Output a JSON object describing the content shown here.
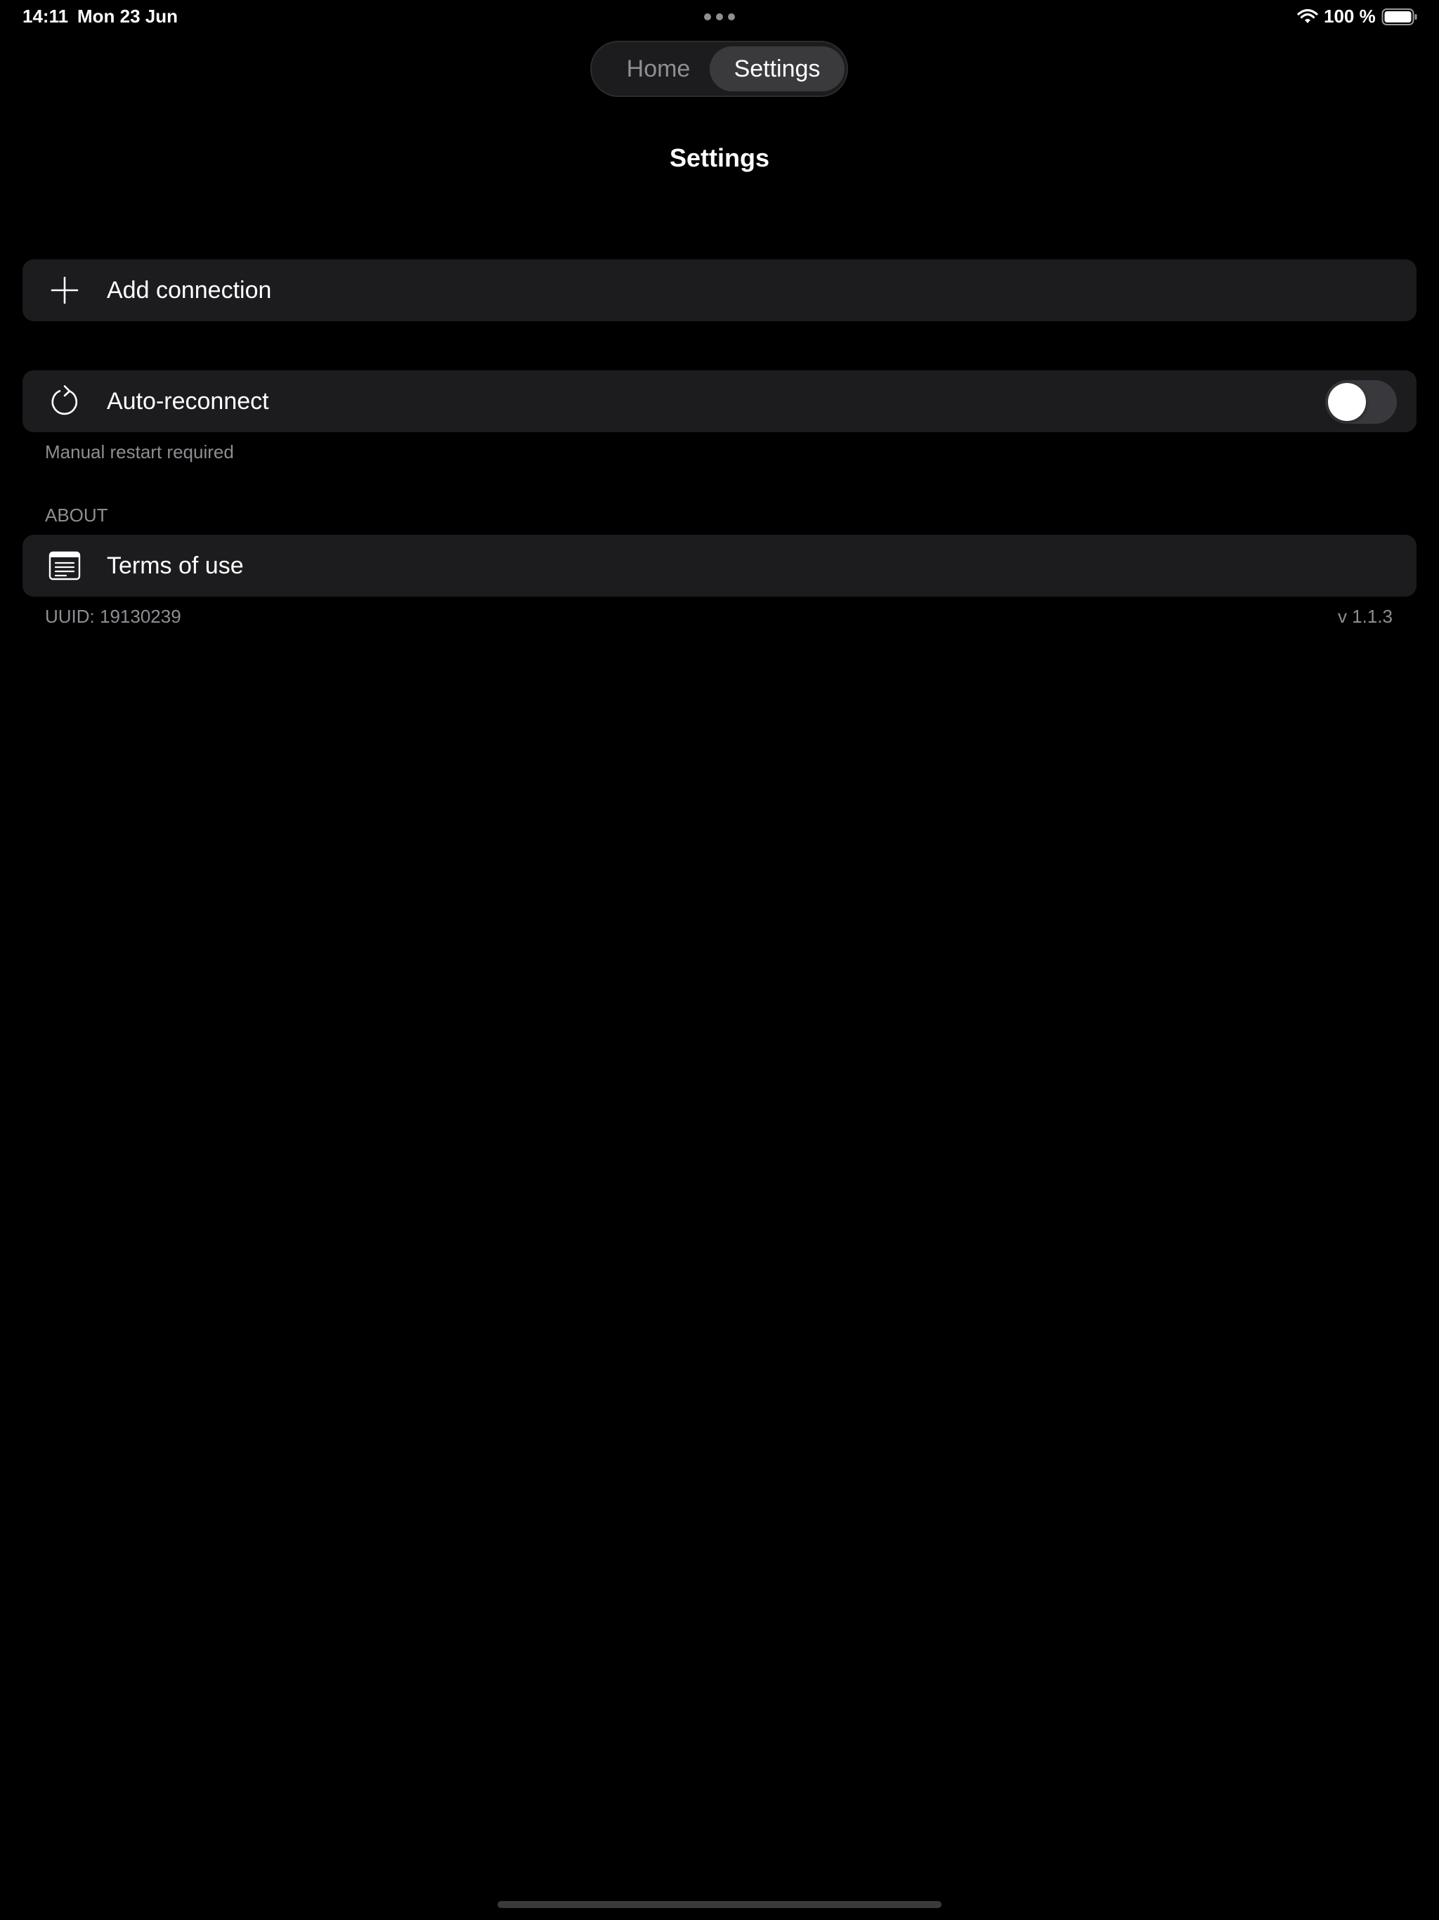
{
  "status_bar": {
    "time": "14:11",
    "date": "Mon 23 Jun",
    "battery": "100 %"
  },
  "tabs": {
    "home": "Home",
    "settings": "Settings",
    "selected": "Settings"
  },
  "page": {
    "title": "Settings"
  },
  "connections": {
    "add_label": "Add connection"
  },
  "auto_reconnect": {
    "label": "Auto-reconnect",
    "enabled": false,
    "footnote": "Manual restart required"
  },
  "about": {
    "header": "ABOUT",
    "terms_label": "Terms of use",
    "uuid": "UUID: 19130239",
    "version": "v 1.1.3"
  },
  "colors": {
    "background": "#000000",
    "cell": "#1c1c1e",
    "secondary_text": "#8e8e93",
    "toggle_off": "#39393d"
  },
  "icons": {
    "add": "plus-icon",
    "auto_reconnect": "refresh-icon",
    "terms": "document-icon",
    "wifi": "wifi-icon",
    "battery": "battery-icon"
  }
}
